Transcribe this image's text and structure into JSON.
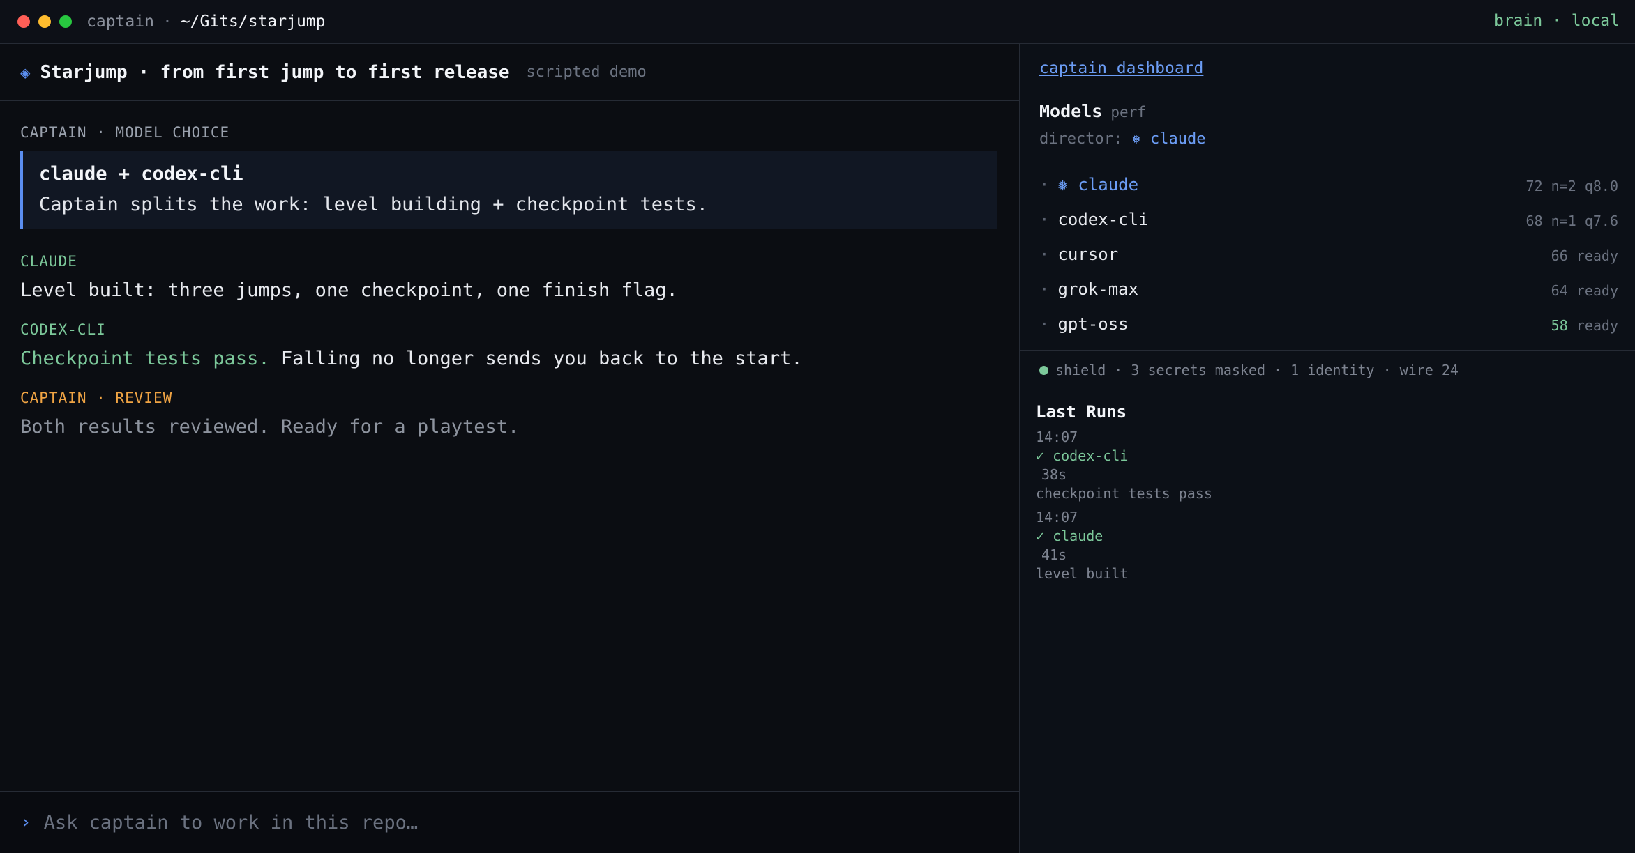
{
  "titlebar": {
    "app": "captain",
    "separator": "·",
    "path": "~/Gits/starjump",
    "status": "brain · local"
  },
  "header": {
    "icon": "diamond-icon",
    "title": "Starjump · from first jump to first release",
    "subtitle": "scripted demo"
  },
  "feed": {
    "captain_label": "CAPTAIN · MODEL CHOICE",
    "choice_title": "claude + codex-cli",
    "choice_desc": "Captain splits the work: level building + checkpoint tests.",
    "claude_label": "CLAUDE",
    "claude_msg": "Level built: three jumps, one checkpoint, one finish flag.",
    "codex_label": "CODEX-CLI",
    "codex_ok": "Checkpoint tests pass.",
    "codex_msg": " Falling no longer sends you back to the start.",
    "review_label": "CAPTAIN · REVIEW",
    "review_msg": "Both results reviewed. Ready for a playtest."
  },
  "prompt": {
    "chevron": "›",
    "placeholder": "Ask captain to work in this repo…"
  },
  "sidebar": {
    "dashboard_link": "captain dashboard",
    "models_title": "Models",
    "models_sub": "perf",
    "director_label": "director:",
    "director_icon": "❅",
    "director_name": "claude",
    "models": [
      {
        "bullet": "·",
        "icon": "❅",
        "name": "claude",
        "meta": "72 n=2 q8.0"
      },
      {
        "bullet": "·",
        "name": "codex-cli",
        "meta": "68 n=1 q7.6"
      },
      {
        "bullet": "·",
        "name": "cursor",
        "meta": "66 ready"
      },
      {
        "bullet": "·",
        "name": "grok-max",
        "meta": "64 ready"
      },
      {
        "bullet": "·",
        "name": "gpt-oss",
        "score": "58",
        "meta": " ready"
      }
    ],
    "shield": "shield · 3 secrets masked · 1 identity · wire 24",
    "runs_title": "Last Runs",
    "runs": [
      {
        "time": "14:07",
        "agent": "✓ codex-cli",
        "duration": "38s",
        "note": "checkpoint tests pass"
      },
      {
        "time": "14:07",
        "agent": "✓ claude",
        "duration": "41s",
        "note": "level built"
      }
    ]
  },
  "colors": {
    "accent_blue": "#5b8ef0",
    "success_green": "#7cc89a",
    "review_orange": "#f0a444"
  }
}
